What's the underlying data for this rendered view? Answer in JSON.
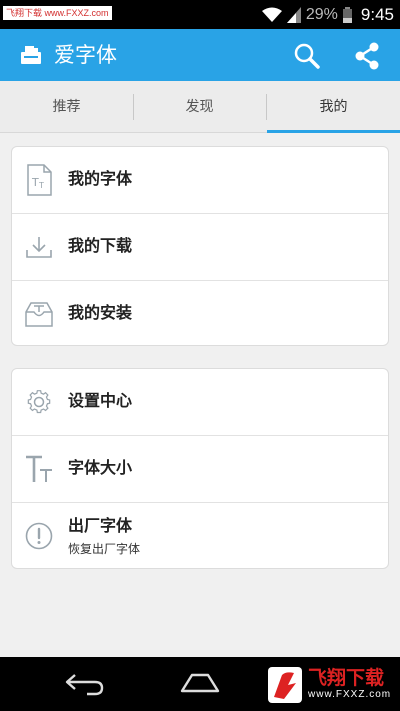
{
  "status_bar": {
    "watermark": "飞翔下载 www.FXXZ.com",
    "battery": "29%",
    "time": "9:45"
  },
  "action_bar": {
    "title": "爱字体",
    "icons": [
      "app-icon",
      "search-icon",
      "share-icon"
    ]
  },
  "tabs": [
    {
      "label": "推荐",
      "selected": false
    },
    {
      "label": "发现",
      "selected": false
    },
    {
      "label": "我的",
      "selected": true
    }
  ],
  "card1": {
    "items": [
      {
        "label": "我的字体",
        "icon": "font-file-icon"
      },
      {
        "label": "我的下载",
        "icon": "download-icon"
      },
      {
        "label": "我的安装",
        "icon": "install-tray-icon"
      }
    ]
  },
  "card2": {
    "items": [
      {
        "label": "设置中心",
        "icon": "gear-icon"
      },
      {
        "label": "字体大小",
        "icon": "font-size-icon"
      },
      {
        "label": "出厂字体",
        "sublabel": "恢复出厂字体",
        "icon": "exclamation-icon"
      }
    ]
  },
  "nav_bar": {
    "logo_text": "飞翔下载",
    "logo_url": "www.FXXZ.com"
  },
  "colors": {
    "accent": "#29a3e6",
    "background": "#f0f0f0",
    "icon_gray": "#9aa5ad"
  }
}
